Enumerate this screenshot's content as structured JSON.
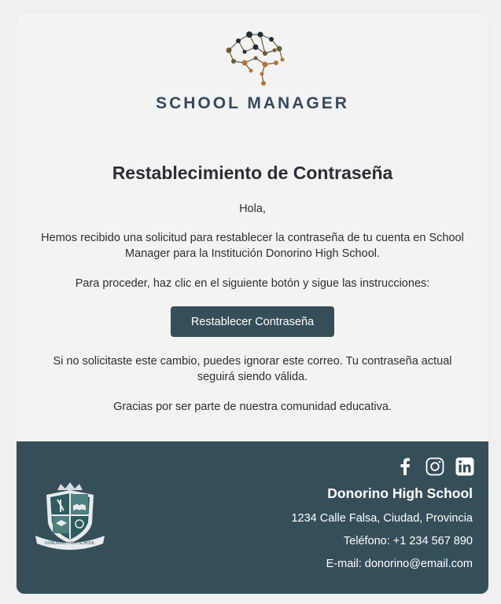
{
  "brand": {
    "name": "SCHOOL MANAGER",
    "logo_icon": "brain-network-icon"
  },
  "title": "Restablecimiento de Contraseña",
  "greeting": "Hola,",
  "paragraph1": "Hemos recibido una solicitud para restablecer la contraseña de tu cuenta en School Manager para la Institución Donorino High School.",
  "paragraph2": "Para proceder, haz clic en el siguiente botón y sigue las instrucciones:",
  "reset_button": "Restablecer Contraseña",
  "paragraph3": "Si no solicitaste este cambio, puedes ignorar este correo. Tu contraseña actual seguirá siendo válida.",
  "paragraph4": "Gracias por ser parte de nuestra comunidad educativa.",
  "footer": {
    "school_name": "Donorino High School",
    "address": "1234 Calle Falsa, Ciudad, Provincia",
    "phone": "Teléfono: +1 234 567 890",
    "email": "E-mail: donorino@email.com",
    "crest_label": "DONORINO HIGH SCHOOL",
    "social": [
      "facebook-icon",
      "instagram-icon",
      "linkedin-icon"
    ]
  },
  "colors": {
    "accent": "#354f5a",
    "brand_text": "#34495e",
    "logo_copper": "#b8732f"
  }
}
